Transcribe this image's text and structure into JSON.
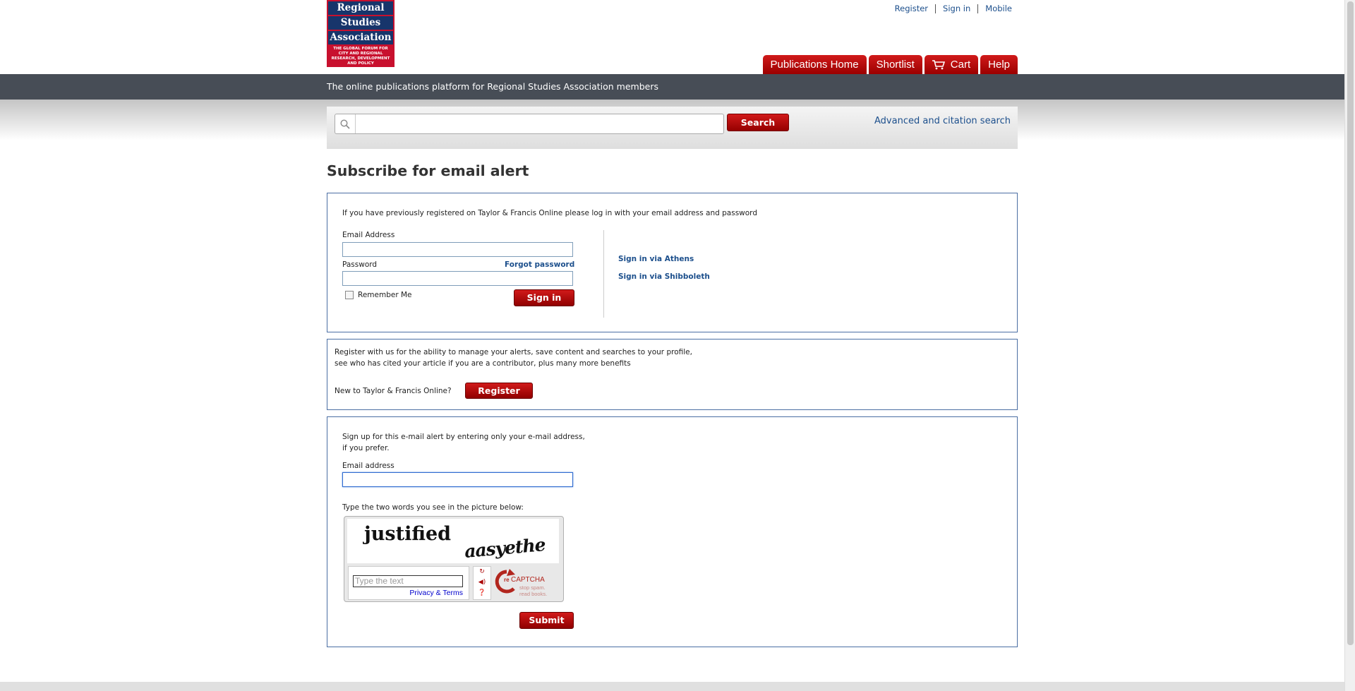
{
  "logo": {
    "lines": [
      "Regional",
      "Studies",
      "Association"
    ],
    "tagline": "THE GLOBAL FORUM FOR CITY AND REGIONAL RESEARCH, DEVELOPMENT AND POLICY"
  },
  "top_links": [
    "Register",
    "Sign in",
    "Mobile"
  ],
  "nav_tabs": [
    {
      "label": "Publications Home"
    },
    {
      "label": "Shortlist"
    },
    {
      "label": "Cart",
      "icon": "cart-icon"
    },
    {
      "label": "Help"
    }
  ],
  "tagline": "The online publications platform for Regional Studies Association members",
  "search": {
    "placeholder": "",
    "button_label": "Search",
    "advanced_link": "Advanced and citation search"
  },
  "page_title": "Subscribe for email alert",
  "login": {
    "intro": "If you have previously registered on Taylor & Francis Online please log in with your email address and password",
    "email_label": "Email Address",
    "password_label": "Password",
    "forgot_link": "Forgot password",
    "remember_label": "Remember Me",
    "signin_button": "Sign in",
    "athens_link": "Sign in via Athens",
    "shibboleth_link": "Sign in via Shibboleth"
  },
  "register": {
    "line1": "Register with us for the ability to manage your alerts, save content and searches to your profile,",
    "line2": "see who has cited your article if you are a contributor, plus many more benefits",
    "new_label": "New to Taylor & Francis Online?",
    "button": "Register"
  },
  "signup": {
    "line1": "Sign up for this e-mail alert by entering only your e-mail address,",
    "line2": "if you prefer.",
    "email_label": "Email address",
    "captcha_prompt": "Type the two words you see in the picture below:",
    "captcha_word1": "justified",
    "captcha_word2": "aasyethe",
    "captcha_placeholder": "Type the text",
    "captcha_privacy": "Privacy & Terms",
    "submit_button": "Submit"
  },
  "colors": {
    "brand_red": "#c8102e",
    "brand_blue": "#17356b",
    "band_gray": "#474d56",
    "link_blue": "#1c4f8c"
  }
}
